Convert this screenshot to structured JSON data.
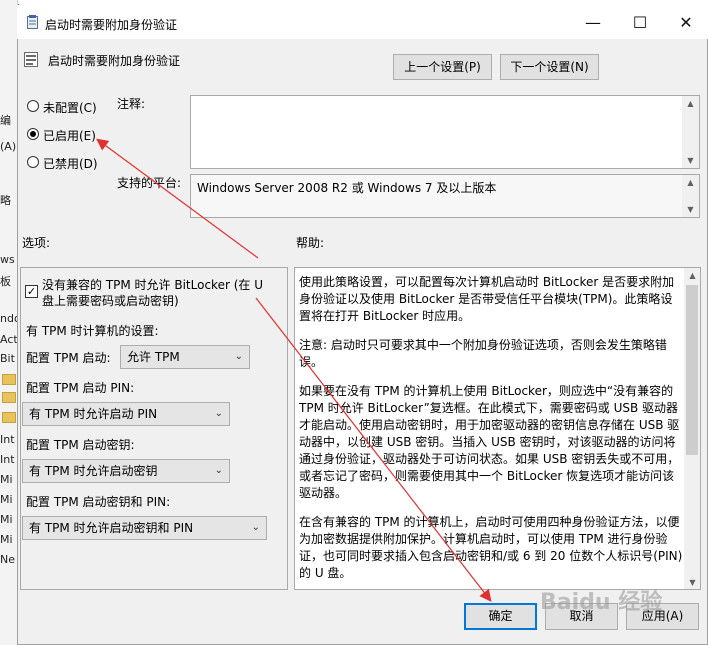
{
  "window": {
    "title": "启动时需要附加身份验证",
    "minimize": "—",
    "maximize": "☐",
    "close": "✕"
  },
  "header": {
    "setting_name": "启动时需要附加身份验证",
    "prev_button": "上一个设置(P)",
    "next_button": "下一个设置(N)"
  },
  "radios": {
    "not_configured": "未配置(C)",
    "enabled": "已启用(E)",
    "disabled": "已禁用(D)",
    "selected": "enabled"
  },
  "comment": {
    "label": "注释:",
    "value": ""
  },
  "platform": {
    "label": "支持的平台:",
    "value": "Windows Server 2008 R2 或 Windows 7 及以上版本"
  },
  "options": {
    "label": "选项:",
    "allow_no_tpm_line1": "没有兼容的 TPM 时允许 BitLocker (在 U",
    "allow_no_tpm_line2": "盘上需要密码或启动密钥)",
    "allow_no_tpm_checked": true,
    "tpm_settings_title": "有 TPM 时计算机的设置:",
    "tpm_startup_label": "配置 TPM 启动:",
    "tpm_startup_value": "允许 TPM",
    "tpm_pin_label": "配置 TPM 启动 PIN:",
    "tpm_pin_value": "有 TPM 时允许启动 PIN",
    "tpm_key_label": "配置 TPM 启动密钥:",
    "tpm_key_value": "有 TPM 时允许启动密钥",
    "tpm_key_pin_label": "配置 TPM 启动密钥和 PIN:",
    "tpm_key_pin_value": "有 TPM 时允许启动密钥和 PIN"
  },
  "help": {
    "label": "帮助:",
    "paragraphs": [
      "使用此策略设置，可以配置每次计算机启动时 BitLocker 是否要求附加身份验证以及使用 BitLocker 是否带受信任平台模块(TPM)。此策略设置将在打开 BitLocker 时应用。",
      "注意: 启动时只可要求其中一个附加身份验证选项，否则会发生策略错误。",
      "如果要在没有 TPM 的计算机上使用 BitLocker，则应选中“没有兼容的 TPM 时允许 BitLocker”复选框。在此模式下，需要密码或 USB 驱动器才能启动。使用启动密钥时，用于加密驱动器的密钥信息存储在 USB 驱动器中，以创建 USB 密钥。当插入 USB 密钥时，对该驱动器的访问将通过身份验证，驱动器处于可访问状态。如果 USB 密钥丢失或不可用，或者忘记了密码，则需要使用其中一个 BitLocker 恢复选项才能访问该驱动器。",
      "在含有兼容的 TPM 的计算机上，启动时可使用四种身份验证方法，以便为加密数据提供附加保护。计算机启动时，可以使用 TPM 进行身份验证，也可同时要求插入包含启动密钥和/或 6 到 20 位数个人标识号(PIN)的 U 盘。"
    ]
  },
  "footer": {
    "ok": "确定",
    "cancel": "取消",
    "apply": "应用(A)"
  },
  "background_window": {
    "top": "加密",
    "items": [
      "编",
      "(A)",
      "略",
      "",
      "ws",
      "板",
      "ndo",
      "Act",
      "Bit",
      "",
      "",
      "Int",
      "Int",
      "Mi",
      "Mi",
      "Mi",
      "Mi",
      "Ne"
    ]
  },
  "watermark": "Baidu 经验"
}
